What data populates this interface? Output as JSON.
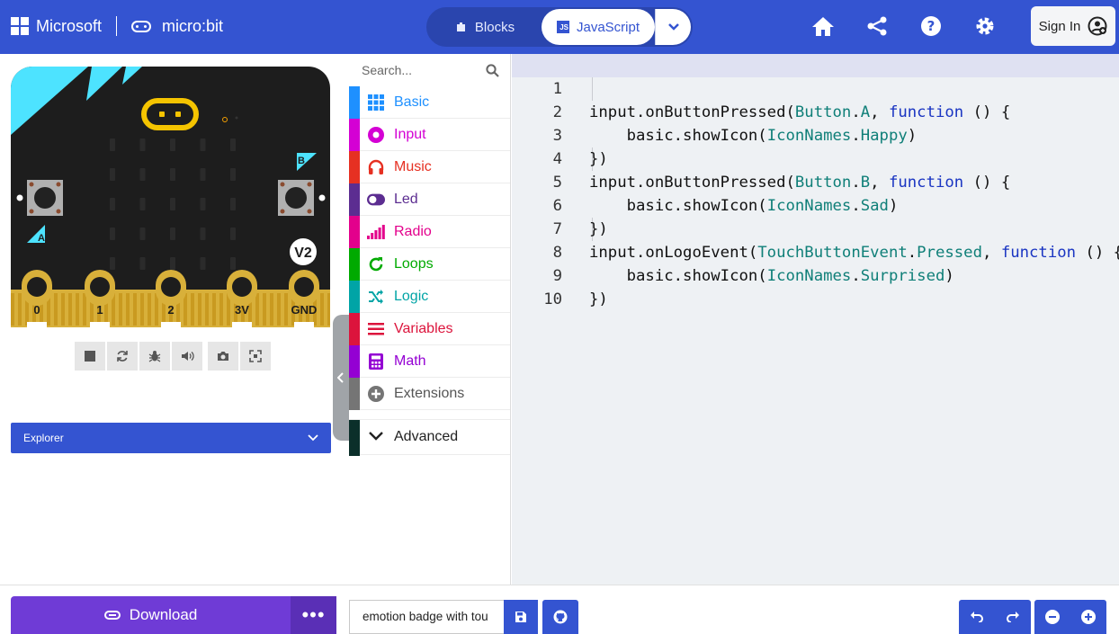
{
  "header": {
    "brand": "Microsoft",
    "product": "micro:bit",
    "mode_blocks": "Blocks",
    "mode_javascript": "JavaScript",
    "sign_in": "Sign In",
    "icons": [
      "home-icon",
      "share-icon",
      "help-icon",
      "settings-icon"
    ]
  },
  "simulator": {
    "version_badge": "V2",
    "button_a": "A",
    "button_b": "B",
    "pins": [
      "0",
      "1",
      "2",
      "3V",
      "GND"
    ],
    "controls": [
      "stop-icon",
      "restart-icon",
      "debug-icon",
      "sound-icon",
      "screenshot-icon",
      "fullscreen-icon"
    ],
    "explorer_label": "Explorer"
  },
  "toolbox": {
    "search_placeholder": "Search...",
    "categories": [
      {
        "label": "Basic",
        "color": "#1e90ff",
        "icon": "grid-icon"
      },
      {
        "label": "Input",
        "color": "#d400d4",
        "icon": "input-icon"
      },
      {
        "label": "Music",
        "color": "#e63022",
        "icon": "headphones-icon"
      },
      {
        "label": "Led",
        "color": "#5c2d91",
        "icon": "toggle-icon"
      },
      {
        "label": "Radio",
        "color": "#e3008c",
        "icon": "signal-icon"
      },
      {
        "label": "Loops",
        "color": "#00aa00",
        "icon": "loop-icon"
      },
      {
        "label": "Logic",
        "color": "#00a4a6",
        "icon": "shuffle-icon"
      },
      {
        "label": "Variables",
        "color": "#dc143c",
        "icon": "list-icon"
      },
      {
        "label": "Math",
        "color": "#9400d3",
        "icon": "calculator-icon"
      },
      {
        "label": "Extensions",
        "color": "#757575",
        "icon": "plus-icon"
      }
    ],
    "advanced_label": "Advanced"
  },
  "editor": {
    "line_numbers": [
      "1",
      "2",
      "3",
      "4",
      "5",
      "6",
      "7",
      "8",
      "9",
      "10"
    ]
  },
  "footer": {
    "download_label": "Download",
    "more_label": "•••",
    "project_name": "emotion badge with tou"
  }
}
